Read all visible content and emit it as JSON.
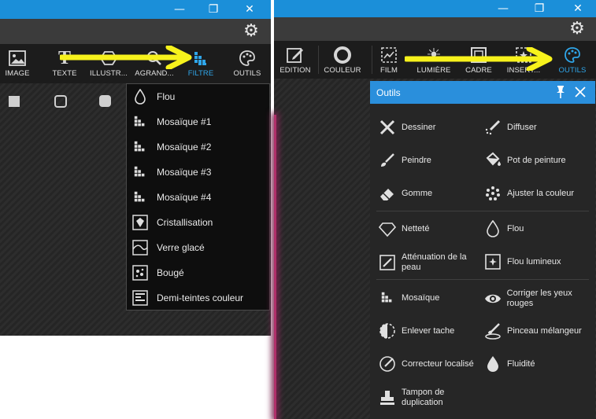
{
  "left": {
    "tabs": [
      {
        "label": "IMAGE",
        "icon": "image-icon"
      },
      {
        "label": "TEXTE",
        "icon": "text-icon"
      },
      {
        "label": "ILLUSTR...",
        "icon": "illustration-icon"
      },
      {
        "label": "AGRAND...",
        "icon": "magnify-icon"
      },
      {
        "label": "FILTRE",
        "icon": "mosaic-icon",
        "active": true
      },
      {
        "label": "OUTILS",
        "icon": "palette-icon"
      }
    ],
    "menu": [
      {
        "label": "Flou",
        "icon": "drop-icon"
      },
      {
        "label": "Mosaïque #1",
        "icon": "mosaic-icon"
      },
      {
        "label": "Mosaïque #2",
        "icon": "mosaic-icon"
      },
      {
        "label": "Mosaïque #3",
        "icon": "mosaic-icon"
      },
      {
        "label": "Mosaïque #4",
        "icon": "mosaic-icon"
      },
      {
        "label": "Cristallisation",
        "icon": "crystal-icon"
      },
      {
        "label": "Verre glacé",
        "icon": "frosted-glass-icon"
      },
      {
        "label": "Bougé",
        "icon": "motion-icon"
      },
      {
        "label": "Demi-teintes couleur",
        "icon": "halftone-icon"
      }
    ]
  },
  "right": {
    "tabs": [
      {
        "label": "EDITION",
        "icon": "edit-icon"
      },
      {
        "label": "COULEUR",
        "icon": "color-ring-icon"
      },
      {
        "label": "FILM",
        "icon": "film-icon"
      },
      {
        "label": "LUMIÈRE",
        "icon": "sun-icon"
      },
      {
        "label": "CADRE",
        "icon": "frame-icon"
      },
      {
        "label": "INSERT...",
        "icon": "insert-icon"
      },
      {
        "label": "OUTILS",
        "icon": "palette-icon",
        "active": true
      }
    ],
    "panel": {
      "title": "Outils",
      "groups": [
        [
          {
            "label": "Dessiner",
            "icon": "draw-icon"
          },
          {
            "label": "Diffuser",
            "icon": "spray-icon"
          },
          {
            "label": "Peindre",
            "icon": "brush-icon"
          },
          {
            "label": "Pot de peinture",
            "icon": "paint-bucket-icon"
          },
          {
            "label": "Gomme",
            "icon": "eraser-icon"
          },
          {
            "label": "Ajuster la couleur",
            "icon": "adjust-color-icon"
          }
        ],
        [
          {
            "label": "Netteté",
            "icon": "sharpen-icon"
          },
          {
            "label": "Flou",
            "icon": "drop-icon"
          },
          {
            "label": "Atténuation de la peau",
            "icon": "skin-icon"
          },
          {
            "label": "Flou lumineux",
            "icon": "glow-icon"
          }
        ],
        [
          {
            "label": "Mosaïque",
            "icon": "mosaic-icon"
          },
          {
            "label": "Corriger les yeux rouges",
            "icon": "eye-icon"
          },
          {
            "label": "Enlever tache",
            "icon": "spot-icon"
          },
          {
            "label": "Pinceau mélangeur",
            "icon": "mixer-brush-icon"
          },
          {
            "label": "Correcteur localisé",
            "icon": "local-fix-icon"
          },
          {
            "label": "Fluidité",
            "icon": "liquify-icon"
          },
          {
            "label": "Tampon de duplication",
            "icon": "stamp-icon"
          }
        ]
      ]
    }
  },
  "window_controls": {
    "minimize": "—",
    "restore": "❐",
    "close": "✕"
  },
  "colors": {
    "accent": "#2fa6ea",
    "titlebar": "#1b8fd9",
    "arrow": "#f7f21c",
    "panel_header": "#2a8fdc"
  }
}
